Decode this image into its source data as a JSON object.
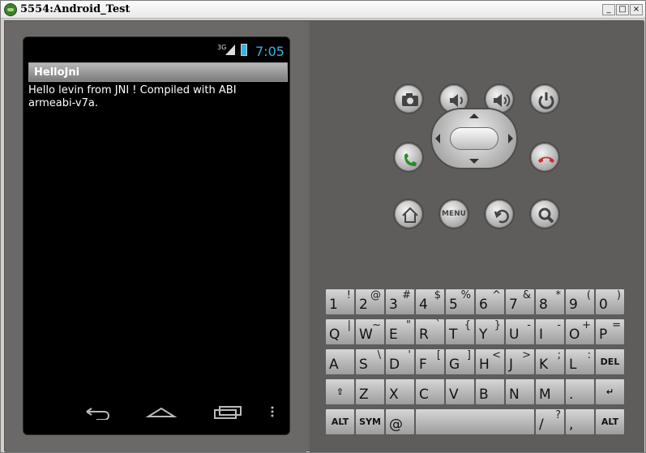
{
  "window": {
    "title": "5554:Android_Test",
    "minimize_label": "_",
    "maximize_label": "□",
    "close_label": "×"
  },
  "device": {
    "status": {
      "network": "3G",
      "time": "7:05"
    },
    "app_title": "HelloJni",
    "message": "Hello levin from JNI !  Compiled with ABI armeabi-v7a.",
    "nav": [
      "back-icon",
      "home-icon",
      "recent-apps-icon",
      "overflow-menu-icon"
    ]
  },
  "controls": {
    "top_row": [
      "camera-icon",
      "volume-down-icon",
      "volume-up-icon",
      "power-icon"
    ],
    "middle_row": [
      "call-icon",
      "dpad",
      "end-call-icon"
    ],
    "bottom_row": [
      "home-icon",
      "menu-label",
      "back-icon",
      "search-icon"
    ],
    "menu_label": "MENU"
  },
  "keyboard": {
    "rows": [
      [
        {
          "main": "1",
          "alt": "!"
        },
        {
          "main": "2",
          "alt": "@"
        },
        {
          "main": "3",
          "alt": "#"
        },
        {
          "main": "4",
          "alt": "$"
        },
        {
          "main": "5",
          "alt": "%"
        },
        {
          "main": "6",
          "alt": "^"
        },
        {
          "main": "7",
          "alt": "&"
        },
        {
          "main": "8",
          "alt": "*"
        },
        {
          "main": "9",
          "alt": "("
        },
        {
          "main": "0",
          "alt": ")"
        }
      ],
      [
        {
          "main": "Q",
          "alt": "|"
        },
        {
          "main": "W",
          "alt": "~"
        },
        {
          "main": "E",
          "alt": "\""
        },
        {
          "main": "R",
          "alt": "`"
        },
        {
          "main": "T",
          "alt": "{"
        },
        {
          "main": "Y",
          "alt": "}"
        },
        {
          "main": "U",
          "alt": "-"
        },
        {
          "main": "I",
          "alt": "-"
        },
        {
          "main": "O",
          "alt": "+"
        },
        {
          "main": "P",
          "alt": "="
        }
      ],
      [
        {
          "main": "A",
          "alt": ""
        },
        {
          "main": "S",
          "alt": "\\"
        },
        {
          "main": "D",
          "alt": "'"
        },
        {
          "main": "F",
          "alt": "["
        },
        {
          "main": "G",
          "alt": "]"
        },
        {
          "main": "H",
          "alt": "<"
        },
        {
          "main": "J",
          "alt": ">"
        },
        {
          "main": "K",
          "alt": ";"
        },
        {
          "main": "L",
          "alt": ":"
        },
        {
          "main": "DEL",
          "alt": ""
        }
      ],
      [
        {
          "main": "⇧",
          "alt": ""
        },
        {
          "main": "Z",
          "alt": ""
        },
        {
          "main": "X",
          "alt": ""
        },
        {
          "main": "C",
          "alt": ""
        },
        {
          "main": "V",
          "alt": ""
        },
        {
          "main": "B",
          "alt": ""
        },
        {
          "main": "N",
          "alt": ""
        },
        {
          "main": "M",
          "alt": ""
        },
        {
          "main": ".",
          "alt": ""
        },
        {
          "main": "↵",
          "alt": ""
        }
      ],
      [
        {
          "main": "ALT",
          "alt": ""
        },
        {
          "main": "SYM",
          "alt": ""
        },
        {
          "main": "@",
          "alt": ""
        },
        {
          "main": "",
          "alt": ""
        },
        {
          "main": "/",
          "alt": "?"
        },
        {
          "main": ",",
          "alt": ""
        },
        {
          "main": "ALT",
          "alt": ""
        }
      ]
    ]
  },
  "colors": {
    "status_accent": "#33b5e5",
    "call_green": "#2a8a2a",
    "end_call_red": "#c83232"
  }
}
